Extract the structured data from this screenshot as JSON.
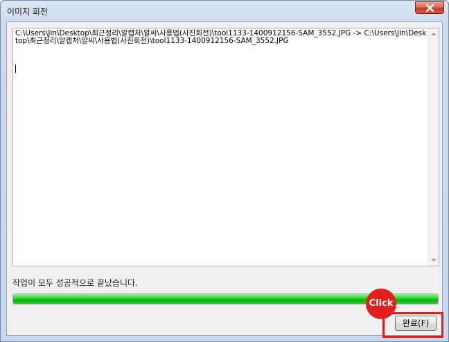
{
  "window": {
    "title": "이미지 회전"
  },
  "log": {
    "text": "C:\\Users\\Jin\\Desktop\\최근정리\\알캡처\\알씨\\사용법(사진회전)\\tool1133-1400912156-SAM_3552.JPG -> C:\\Users\\Jin\\Desktop\\최근정리\\알캡처\\알씨\\사용법(사진회전)\\tool1133-1400912156-SAM_3552.JPG"
  },
  "status": {
    "message": "작업이 모두 성공적으로 끝났습니다.",
    "progress_fraction": 1.0
  },
  "buttons": {
    "done_label": "완료(F)"
  },
  "annotation": {
    "badge_label": "Click",
    "highlight_color": "#e41b1b"
  },
  "colors": {
    "progress_green": "#06b006",
    "highlight_red": "#e01f1f"
  },
  "icons": {
    "close": "close-icon",
    "scroll_up": "scroll-up-arrow-icon",
    "scroll_down": "scroll-down-arrow-icon"
  }
}
